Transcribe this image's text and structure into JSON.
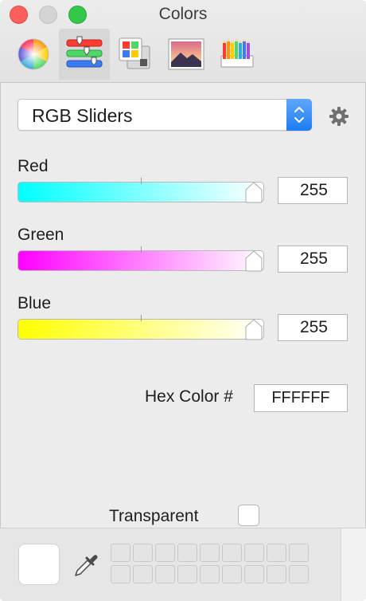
{
  "window": {
    "title": "Colors"
  },
  "toolbar": {
    "buttons": [
      {
        "name": "color-wheel",
        "icon": "color-wheel-icon"
      },
      {
        "name": "color-sliders",
        "icon": "sliders-icon",
        "selected": true
      },
      {
        "name": "color-palettes",
        "icon": "palettes-icon"
      },
      {
        "name": "image-palettes",
        "icon": "image-palette-icon"
      },
      {
        "name": "pencils",
        "icon": "pencils-icon"
      }
    ]
  },
  "mode": {
    "selected": "RGB Sliders"
  },
  "sliders": [
    {
      "label": "Red",
      "value": "255",
      "level": 1.0,
      "gradient_from": "#00ffff",
      "gradient_to": "#ffffff"
    },
    {
      "label": "Green",
      "value": "255",
      "level": 1.0,
      "gradient_from": "#ff00ff",
      "gradient_to": "#ffffff"
    },
    {
      "label": "Blue",
      "value": "255",
      "level": 1.0,
      "gradient_from": "#ffff00",
      "gradient_to": "#ffffff"
    }
  ],
  "hex": {
    "label": "Hex Color #",
    "value": "FFFFFF"
  },
  "transparent": {
    "label": "Transparent",
    "checked": false
  },
  "current_color": "#ffffff",
  "accent_color": "#1c7cf4"
}
